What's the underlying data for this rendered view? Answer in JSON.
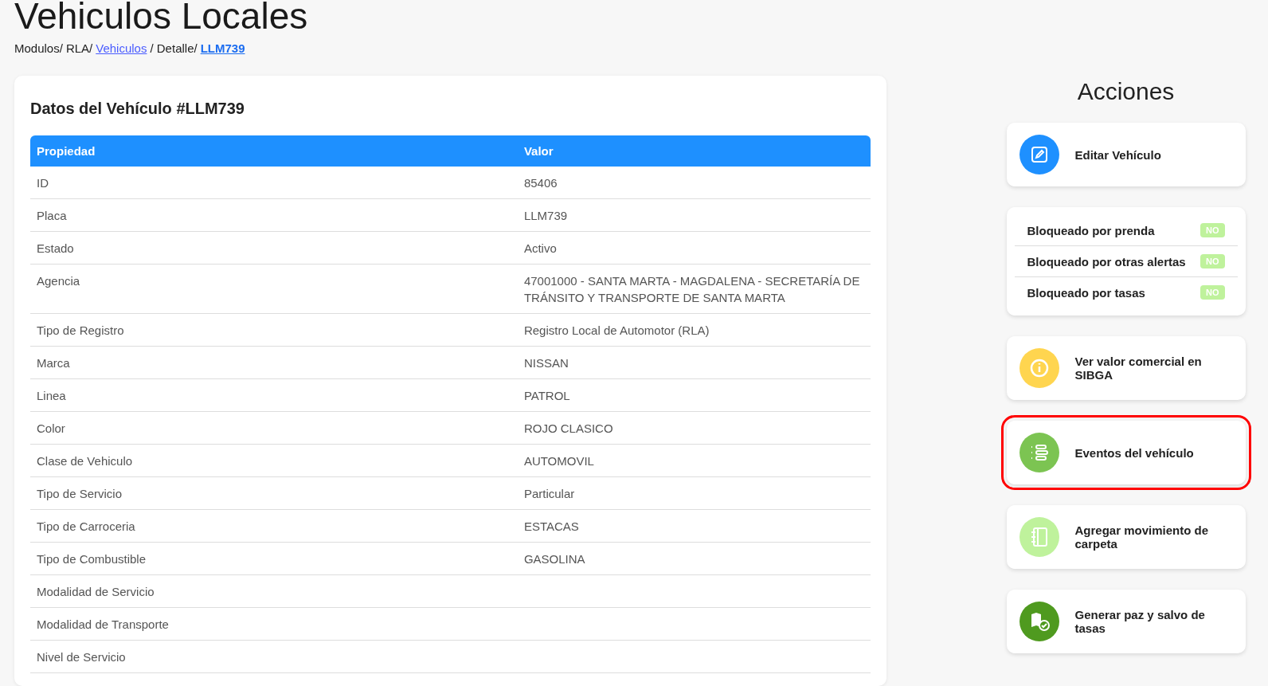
{
  "page_title": "Vehiculos Locales",
  "breadcrumb": [
    {
      "label": "Modulos/",
      "kind": "text"
    },
    {
      "label": "RLA/",
      "kind": "text"
    },
    {
      "label": "Vehiculos",
      "kind": "link"
    },
    {
      "label": "/ Detalle/",
      "kind": "text"
    },
    {
      "label": "LLM739",
      "kind": "current"
    }
  ],
  "details_card": {
    "title": "Datos del Vehículo #LLM739",
    "columns": [
      "Propiedad",
      "Valor"
    ],
    "rows": [
      [
        "ID",
        "85406"
      ],
      [
        "Placa",
        "LLM739"
      ],
      [
        "Estado",
        "Activo"
      ],
      [
        "Agencia",
        "47001000 - SANTA MARTA - MAGDALENA - SECRETARÍA DE TRÁNSITO Y TRANSPORTE DE SANTA MARTA"
      ],
      [
        "Tipo de Registro",
        "Registro Local de Automotor (RLA)"
      ],
      [
        "Marca",
        "NISSAN"
      ],
      [
        "Linea",
        "PATROL"
      ],
      [
        "Color",
        "ROJO CLASICO"
      ],
      [
        "Clase de Vehiculo",
        "AUTOMOVIL"
      ],
      [
        "Tipo de Servicio",
        "Particular"
      ],
      [
        "Tipo de Carroceria",
        "ESTACAS"
      ],
      [
        "Tipo de Combustible",
        "GASOLINA"
      ],
      [
        "Modalidad de Servicio",
        ""
      ],
      [
        "Modalidad de Transporte",
        ""
      ],
      [
        "Nivel de Servicio",
        ""
      ]
    ]
  },
  "actions_title": "Acciones",
  "actions": [
    {
      "kind": "button",
      "color": "#1e90ff",
      "label": "Editar Vehículo",
      "highlighted": false
    },
    {
      "kind": "flags",
      "items": [
        {
          "label": "Bloqueado por prenda",
          "value": "NO"
        },
        {
          "label": "Bloqueado por otras alertas",
          "value": "NO"
        },
        {
          "label": "Bloqueado por tasas",
          "value": "NO"
        }
      ]
    },
    {
      "kind": "button",
      "color": "#ffd54f",
      "label": "Ver valor comercial en SIBGA",
      "highlighted": false
    },
    {
      "kind": "button",
      "color": "#7cc452",
      "label": "Eventos del vehículo",
      "highlighted": true
    },
    {
      "kind": "button",
      "color": "#bff29c",
      "label": "Agregar movimiento de carpeta",
      "highlighted": false
    },
    {
      "kind": "button",
      "color": "#4f9a1f",
      "label": "Generar paz y salvo de tasas",
      "highlighted": false
    }
  ]
}
